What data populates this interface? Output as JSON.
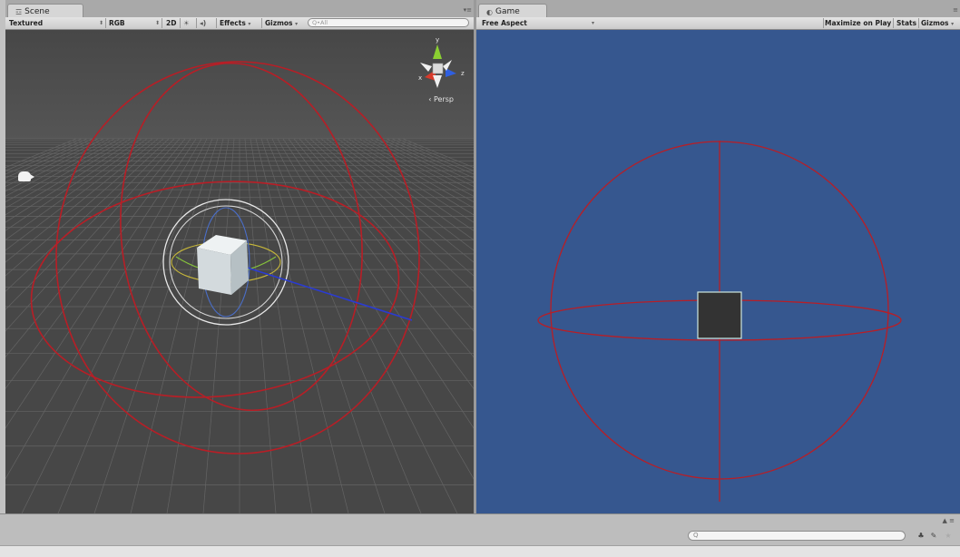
{
  "scene": {
    "tab_title": "Scene",
    "tab_icon": "scene-icon",
    "pane_menu": "▾≡",
    "toolbar": {
      "draw_mode": "Textured",
      "render_mode": "RGB",
      "mode_2d": "2D",
      "lighting_icon": "☀",
      "audio_icon": "◂)",
      "effects": "Effects",
      "gizmos": "Gizmos",
      "search_placeholder": "Q•All"
    },
    "orientation_gizmo": {
      "x": "x",
      "y": "y",
      "z": "z",
      "persp": "‹ Persp"
    }
  },
  "game": {
    "tab_title": "Game",
    "tab_icon": "game-icon",
    "pane_menu": "≡",
    "toolbar": {
      "aspect": "Free Aspect",
      "maximize_on_play": "Maximize on Play",
      "stats": "Stats",
      "gizmos": "Gizmos"
    }
  },
  "bottom": {
    "search_placeholder": "Q",
    "lock": "▲ ≡"
  },
  "colors": {
    "scene_bg": "#474747",
    "game_bg": "#36578f",
    "collider_red": "#b81e26",
    "cube": "#d6dde0",
    "axis_x": "#d33c2c",
    "axis_y": "#86c23c",
    "axis_z": "#2a55d6"
  }
}
